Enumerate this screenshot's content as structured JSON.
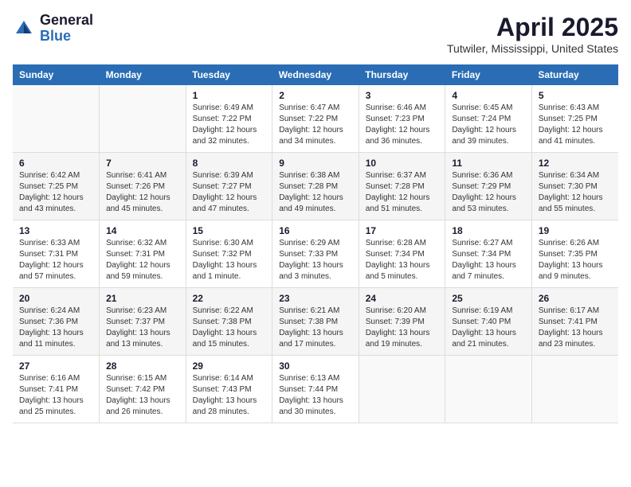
{
  "header": {
    "logo_general": "General",
    "logo_blue": "Blue",
    "month_title": "April 2025",
    "location": "Tutwiler, Mississippi, United States"
  },
  "calendar": {
    "days_of_week": [
      "Sunday",
      "Monday",
      "Tuesday",
      "Wednesday",
      "Thursday",
      "Friday",
      "Saturday"
    ],
    "weeks": [
      [
        {
          "day": "",
          "info": ""
        },
        {
          "day": "",
          "info": ""
        },
        {
          "day": "1",
          "info": "Sunrise: 6:49 AM\nSunset: 7:22 PM\nDaylight: 12 hours\nand 32 minutes."
        },
        {
          "day": "2",
          "info": "Sunrise: 6:47 AM\nSunset: 7:22 PM\nDaylight: 12 hours\nand 34 minutes."
        },
        {
          "day": "3",
          "info": "Sunrise: 6:46 AM\nSunset: 7:23 PM\nDaylight: 12 hours\nand 36 minutes."
        },
        {
          "day": "4",
          "info": "Sunrise: 6:45 AM\nSunset: 7:24 PM\nDaylight: 12 hours\nand 39 minutes."
        },
        {
          "day": "5",
          "info": "Sunrise: 6:43 AM\nSunset: 7:25 PM\nDaylight: 12 hours\nand 41 minutes."
        }
      ],
      [
        {
          "day": "6",
          "info": "Sunrise: 6:42 AM\nSunset: 7:25 PM\nDaylight: 12 hours\nand 43 minutes."
        },
        {
          "day": "7",
          "info": "Sunrise: 6:41 AM\nSunset: 7:26 PM\nDaylight: 12 hours\nand 45 minutes."
        },
        {
          "day": "8",
          "info": "Sunrise: 6:39 AM\nSunset: 7:27 PM\nDaylight: 12 hours\nand 47 minutes."
        },
        {
          "day": "9",
          "info": "Sunrise: 6:38 AM\nSunset: 7:28 PM\nDaylight: 12 hours\nand 49 minutes."
        },
        {
          "day": "10",
          "info": "Sunrise: 6:37 AM\nSunset: 7:28 PM\nDaylight: 12 hours\nand 51 minutes."
        },
        {
          "day": "11",
          "info": "Sunrise: 6:36 AM\nSunset: 7:29 PM\nDaylight: 12 hours\nand 53 minutes."
        },
        {
          "day": "12",
          "info": "Sunrise: 6:34 AM\nSunset: 7:30 PM\nDaylight: 12 hours\nand 55 minutes."
        }
      ],
      [
        {
          "day": "13",
          "info": "Sunrise: 6:33 AM\nSunset: 7:31 PM\nDaylight: 12 hours\nand 57 minutes."
        },
        {
          "day": "14",
          "info": "Sunrise: 6:32 AM\nSunset: 7:31 PM\nDaylight: 12 hours\nand 59 minutes."
        },
        {
          "day": "15",
          "info": "Sunrise: 6:30 AM\nSunset: 7:32 PM\nDaylight: 13 hours\nand 1 minute."
        },
        {
          "day": "16",
          "info": "Sunrise: 6:29 AM\nSunset: 7:33 PM\nDaylight: 13 hours\nand 3 minutes."
        },
        {
          "day": "17",
          "info": "Sunrise: 6:28 AM\nSunset: 7:34 PM\nDaylight: 13 hours\nand 5 minutes."
        },
        {
          "day": "18",
          "info": "Sunrise: 6:27 AM\nSunset: 7:34 PM\nDaylight: 13 hours\nand 7 minutes."
        },
        {
          "day": "19",
          "info": "Sunrise: 6:26 AM\nSunset: 7:35 PM\nDaylight: 13 hours\nand 9 minutes."
        }
      ],
      [
        {
          "day": "20",
          "info": "Sunrise: 6:24 AM\nSunset: 7:36 PM\nDaylight: 13 hours\nand 11 minutes."
        },
        {
          "day": "21",
          "info": "Sunrise: 6:23 AM\nSunset: 7:37 PM\nDaylight: 13 hours\nand 13 minutes."
        },
        {
          "day": "22",
          "info": "Sunrise: 6:22 AM\nSunset: 7:38 PM\nDaylight: 13 hours\nand 15 minutes."
        },
        {
          "day": "23",
          "info": "Sunrise: 6:21 AM\nSunset: 7:38 PM\nDaylight: 13 hours\nand 17 minutes."
        },
        {
          "day": "24",
          "info": "Sunrise: 6:20 AM\nSunset: 7:39 PM\nDaylight: 13 hours\nand 19 minutes."
        },
        {
          "day": "25",
          "info": "Sunrise: 6:19 AM\nSunset: 7:40 PM\nDaylight: 13 hours\nand 21 minutes."
        },
        {
          "day": "26",
          "info": "Sunrise: 6:17 AM\nSunset: 7:41 PM\nDaylight: 13 hours\nand 23 minutes."
        }
      ],
      [
        {
          "day": "27",
          "info": "Sunrise: 6:16 AM\nSunset: 7:41 PM\nDaylight: 13 hours\nand 25 minutes."
        },
        {
          "day": "28",
          "info": "Sunrise: 6:15 AM\nSunset: 7:42 PM\nDaylight: 13 hours\nand 26 minutes."
        },
        {
          "day": "29",
          "info": "Sunrise: 6:14 AM\nSunset: 7:43 PM\nDaylight: 13 hours\nand 28 minutes."
        },
        {
          "day": "30",
          "info": "Sunrise: 6:13 AM\nSunset: 7:44 PM\nDaylight: 13 hours\nand 30 minutes."
        },
        {
          "day": "",
          "info": ""
        },
        {
          "day": "",
          "info": ""
        },
        {
          "day": "",
          "info": ""
        }
      ]
    ]
  }
}
